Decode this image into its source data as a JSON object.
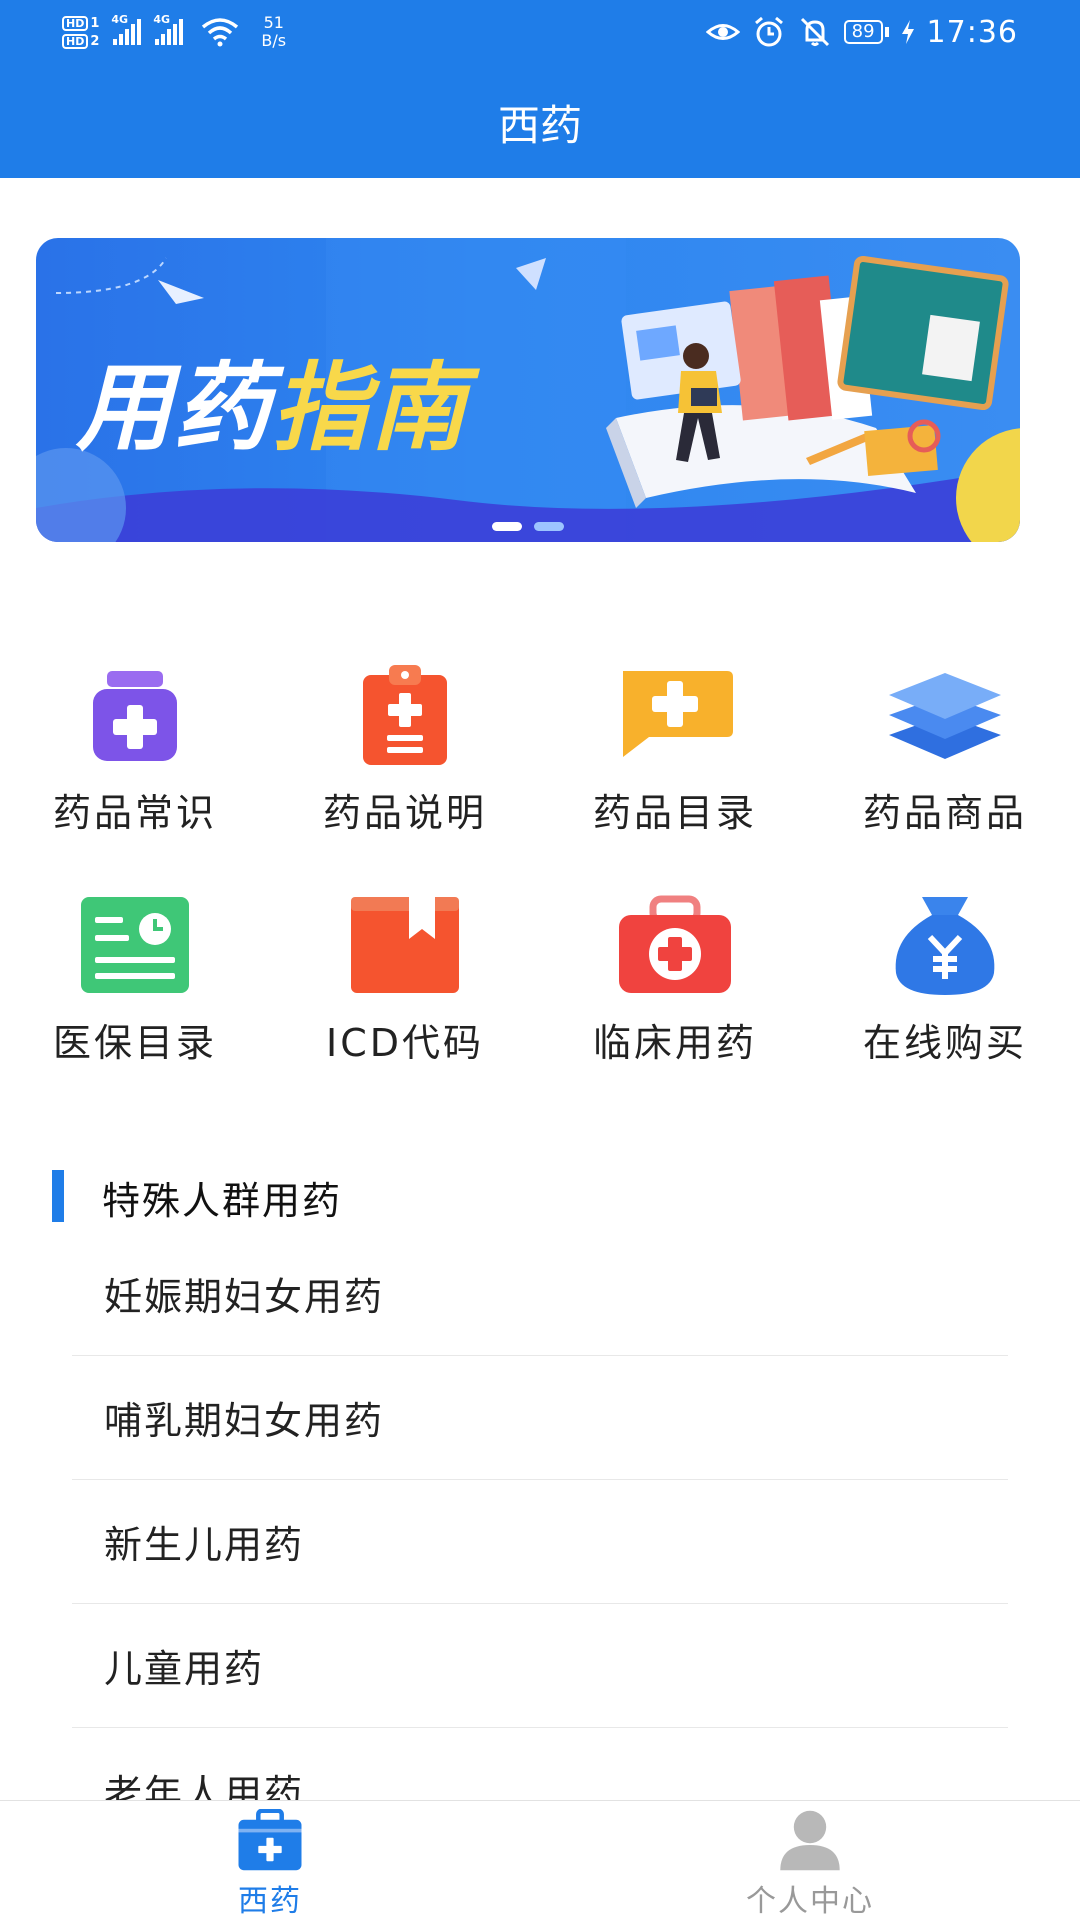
{
  "status_bar": {
    "hd1": "HD",
    "hd1_sub": "1",
    "hd2": "HD",
    "hd2_sub": "2",
    "net1": "4G",
    "net2": "4G",
    "speed_value": "51",
    "speed_unit": "B/s",
    "battery": "89",
    "time": "17:36",
    "icons": [
      "eye-icon",
      "alarm-icon",
      "mute-bell-icon",
      "battery-icon",
      "charging-icon"
    ]
  },
  "header": {
    "title": "西药"
  },
  "banner": {
    "text_white": "用药",
    "text_yellow": "指南",
    "active_slide": 1,
    "slide_count": 2
  },
  "grid": {
    "row1": [
      {
        "label": "药品常识",
        "icon": "medicine-bottle-icon"
      },
      {
        "label": "药品说明",
        "icon": "clipboard-icon"
      },
      {
        "label": "药品目录",
        "icon": "chat-plus-icon"
      },
      {
        "label": "药品商品",
        "icon": "layers-icon"
      }
    ],
    "row2": [
      {
        "label": "医保目录",
        "icon": "insurance-card-icon"
      },
      {
        "label": "ICD代码",
        "icon": "bookmark-book-icon"
      },
      {
        "label": "临床用药",
        "icon": "first-aid-kit-icon"
      },
      {
        "label": "在线购买",
        "icon": "money-bag-icon"
      }
    ]
  },
  "section": {
    "title": "特殊人群用药",
    "items": [
      "妊娠期妇女用药",
      "哺乳期妇女用药",
      "新生儿用药",
      "儿童用药",
      "老年人用药"
    ]
  },
  "tabbar": {
    "tabs": [
      {
        "label": "西药",
        "active": true
      },
      {
        "label": "个人中心",
        "active": false
      }
    ]
  },
  "colors": {
    "primary": "#1f7de8",
    "banner_yellow": "#f8d84a"
  }
}
